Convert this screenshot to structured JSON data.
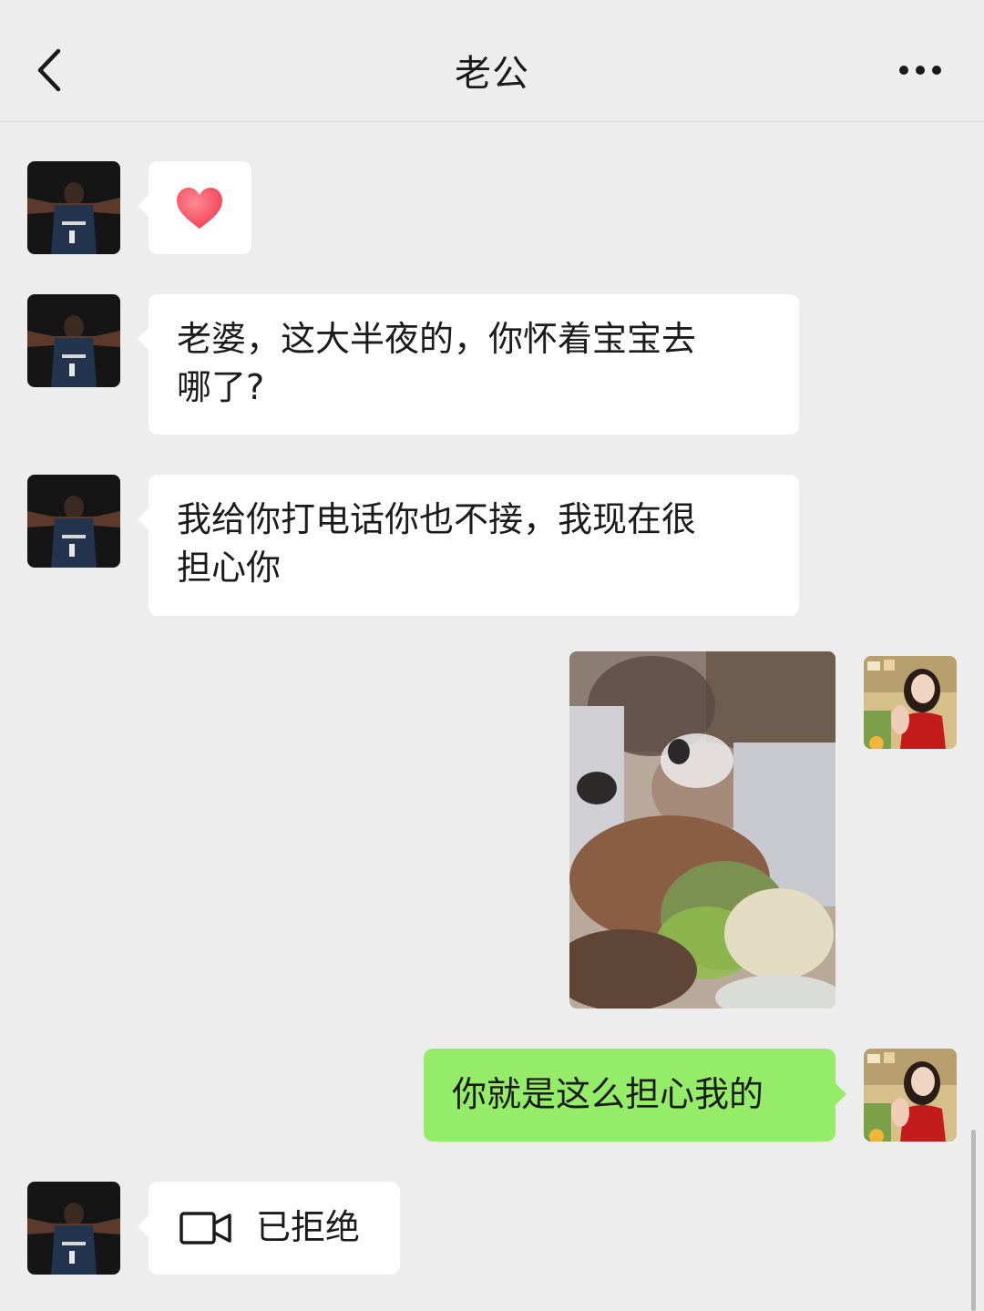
{
  "header": {
    "title": "老公",
    "back_icon": "back-arrow-icon",
    "more_icon": "more-dots-icon"
  },
  "messages": [
    {
      "side": "left",
      "type": "emoji",
      "emoji": "heart-emoji"
    },
    {
      "side": "left",
      "type": "text",
      "text": "老婆，这大半夜的，你怀着宝宝去\n哪了?"
    },
    {
      "side": "left",
      "type": "text",
      "text": "我给你打电话你也不接，我现在很\n担心你"
    },
    {
      "side": "right",
      "type": "image"
    },
    {
      "side": "right",
      "type": "text",
      "text": "你就是这么担心我的"
    },
    {
      "side": "left",
      "type": "call",
      "call_icon": "video-call-icon",
      "status": "已拒绝"
    }
  ],
  "colors": {
    "background": "#ededed",
    "received_bubble": "#ffffff",
    "sent_bubble": "#95ec69",
    "heart": "#f4515f"
  }
}
